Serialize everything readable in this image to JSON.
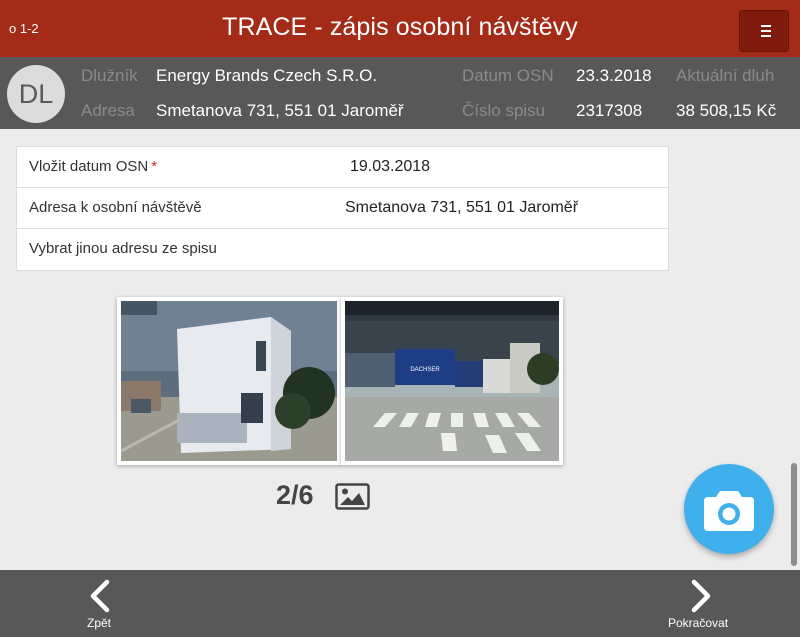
{
  "header": {
    "step": "o 1-2",
    "title": "TRACE - zápis osobní návštěvy",
    "menu_icon": "hamburger-icon"
  },
  "info": {
    "avatar": "DL",
    "debtor_label": "Dlužník",
    "debtor_value": "Energy Brands Czech S.R.O.",
    "address_label": "Adresa",
    "address_value": "Smetanova 731, 551 01 Jaroměř",
    "osn_date_label": "Datum OSN",
    "osn_date_value": "23.3.2018",
    "case_label": "Číslo spisu",
    "case_value": "2317308",
    "debt_label": "Aktuální dluh",
    "debt_value": "38 508,15 Kč"
  },
  "form": {
    "date_label": "Vložit datum OSN",
    "date_required": "*",
    "date_value": "19.03.2018",
    "visit_address_label": "Adresa k osobní návštěvě",
    "visit_address_value": "Smetanova 731, 551 01 Jaroměř",
    "other_address_label": "Vybrat jinou adresu ze spisu"
  },
  "gallery": {
    "counter": "2/6",
    "photo_left_sign": "",
    "photo_right_sign": "DACHSER",
    "icon": "image-icon"
  },
  "fab": {
    "icon": "camera-icon"
  },
  "footer": {
    "back_label": "Zpět",
    "next_label": "Pokračovat"
  },
  "colors": {
    "header": "#a32b17",
    "menu_button": "#7e1b0d",
    "infobar": "#585858",
    "background": "#ececec",
    "fab": "#3fb0ec",
    "required": "#c62828"
  }
}
